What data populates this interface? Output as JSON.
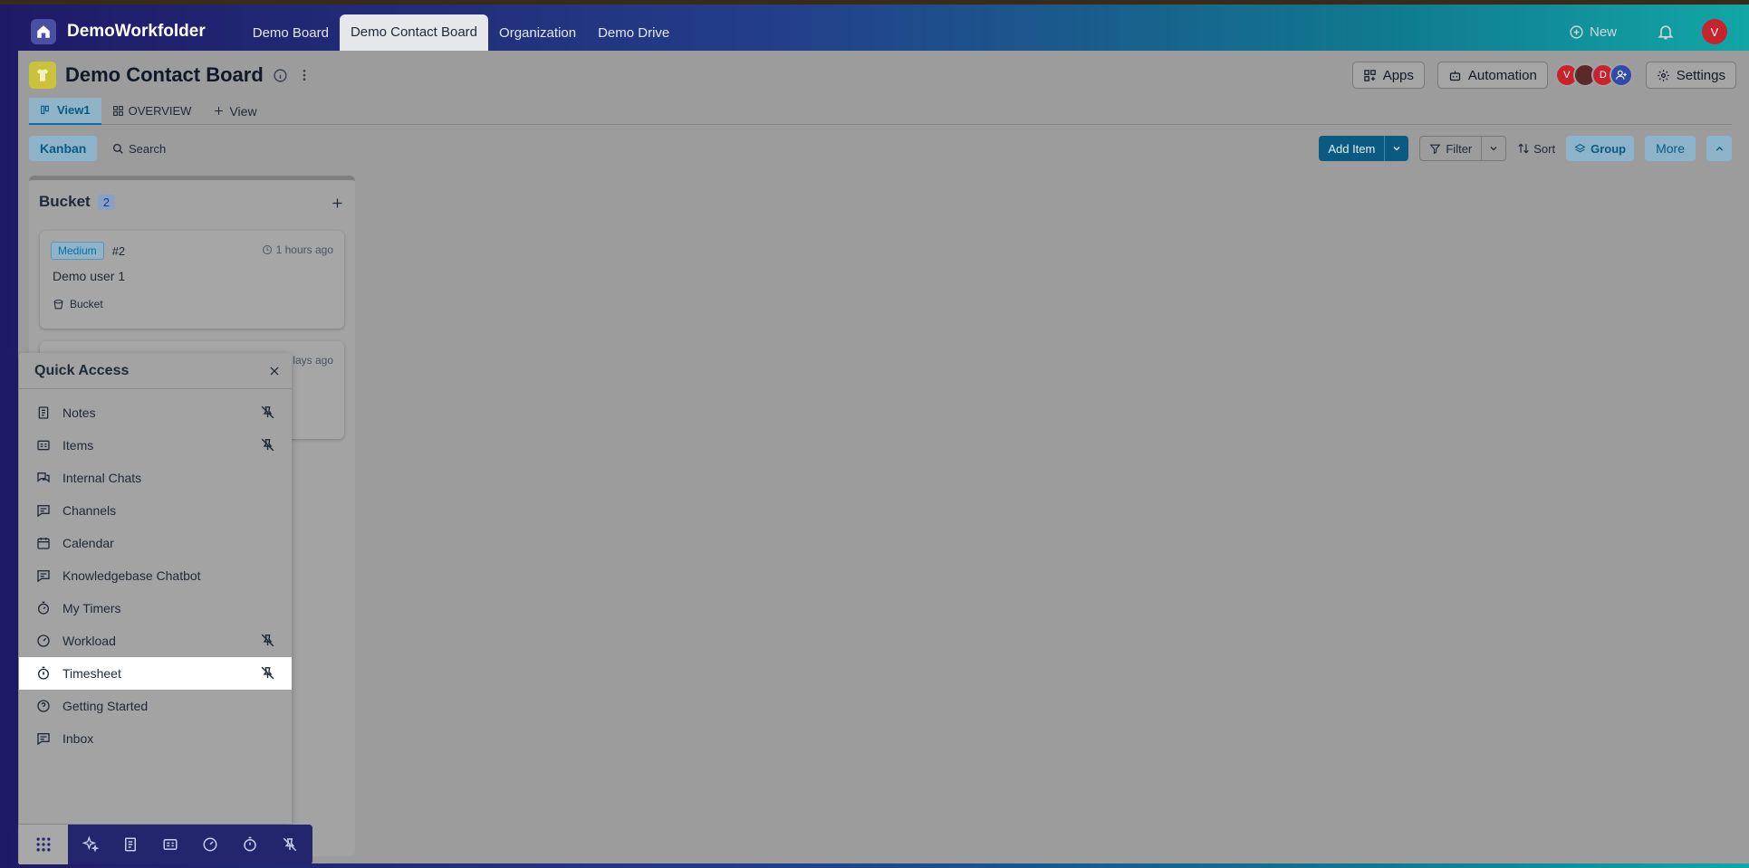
{
  "app": {
    "brand": "DemoWorkfolder",
    "nav_tabs": [
      {
        "label": "Demo Board"
      },
      {
        "label": "Demo Contact Board"
      },
      {
        "label": "Organization"
      },
      {
        "label": "Demo Drive"
      }
    ],
    "new_label": "New",
    "user_initial": "V"
  },
  "board": {
    "title": "Demo Contact Board",
    "actions": {
      "apps": "Apps",
      "automation": "Automation",
      "settings": "Settings"
    },
    "avatars": [
      "V",
      "",
      "D",
      ""
    ],
    "view_tabs": [
      {
        "label": "View1"
      },
      {
        "label": "OVERVIEW"
      },
      {
        "label": "View"
      }
    ],
    "toolbar": {
      "kanban": "Kanban",
      "search": "Search",
      "add_item": "Add Item",
      "filter": "Filter",
      "sort": "Sort",
      "group": "Group",
      "more": "More"
    }
  },
  "column": {
    "title": "Bucket",
    "count": "2",
    "cards": [
      {
        "priority": "Medium",
        "num": "#2",
        "time": "1 hours ago",
        "title": "Demo user 1",
        "tag": "Bucket"
      },
      {
        "priority": "",
        "num": "",
        "time": "lays ago",
        "title": "",
        "tag": ""
      }
    ]
  },
  "quick_access": {
    "title": "Quick Access",
    "items": [
      {
        "label": "Notes",
        "icon": "notes-icon",
        "pinned": true
      },
      {
        "label": "Items",
        "icon": "items-icon",
        "pinned": true
      },
      {
        "label": "Internal Chats",
        "icon": "chats-icon",
        "pinned": false
      },
      {
        "label": "Channels",
        "icon": "channels-icon",
        "pinned": false
      },
      {
        "label": "Calendar",
        "icon": "calendar-icon",
        "pinned": false
      },
      {
        "label": "Knowledgebase Chatbot",
        "icon": "chatbot-icon",
        "pinned": false
      },
      {
        "label": "My Timers",
        "icon": "timer-icon",
        "pinned": false
      },
      {
        "label": "Workload",
        "icon": "gauge-icon",
        "pinned": true
      },
      {
        "label": "Timesheet",
        "icon": "stopwatch-icon",
        "pinned": true
      },
      {
        "label": "Getting Started",
        "icon": "help-icon",
        "pinned": false
      },
      {
        "label": "Inbox",
        "icon": "inbox-icon",
        "pinned": false
      }
    ]
  },
  "colors": {
    "accent": "#0b5a82",
    "avatar_red": "#c8232c",
    "dock_bg": "#23256d"
  }
}
